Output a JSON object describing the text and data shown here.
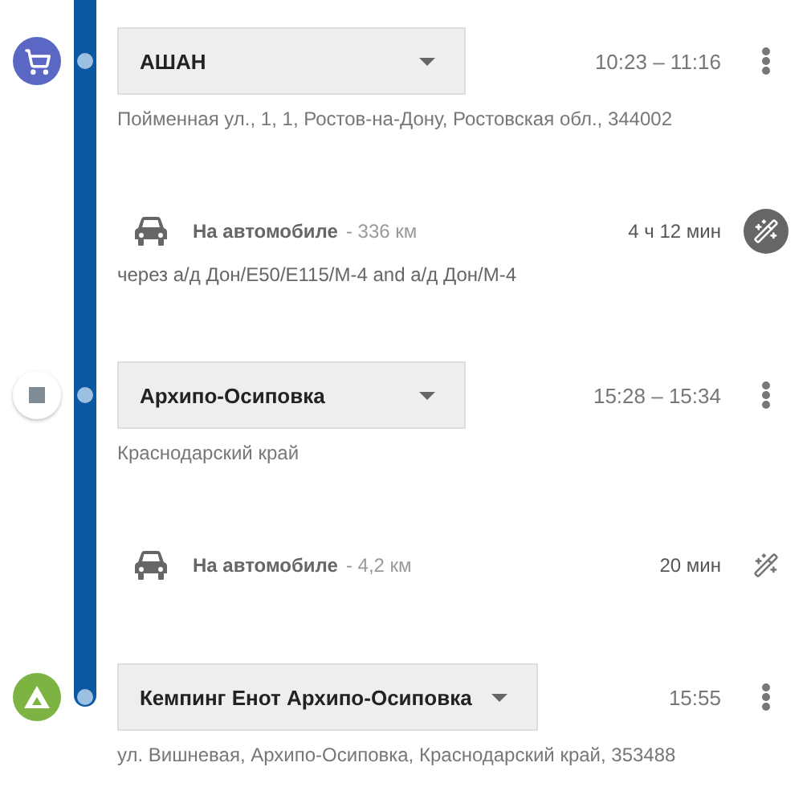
{
  "itinerary": [
    {
      "kind": "shop",
      "name": "АШАН",
      "time": "10:23 – 11:16",
      "address": "Пойменная ул., 1, 1, Ростов-на-Дону, Ростовская обл., 344002"
    },
    {
      "kind": "drive",
      "mode": "На автомобиле",
      "distance": "- 336 км",
      "duration": "4 ч 12 мин",
      "highlighted": true,
      "via": "через а/д Дон/E50/E115/M-4 and а/д Дон/M-4"
    },
    {
      "kind": "waypoint",
      "name": "Архипо-Осиповка",
      "time": "15:28 – 15:34",
      "address": "Краснодарский край"
    },
    {
      "kind": "drive",
      "mode": "На автомобиле",
      "distance": "- 4,2 км",
      "duration": "20 мин",
      "highlighted": false
    },
    {
      "kind": "campsite",
      "name": "Кемпинг Енот Архипо-Осиповка",
      "time": "15:55",
      "address": "ул. Вишневая, Архипо-Осиповка, Краснодарский край, 353488"
    }
  ]
}
